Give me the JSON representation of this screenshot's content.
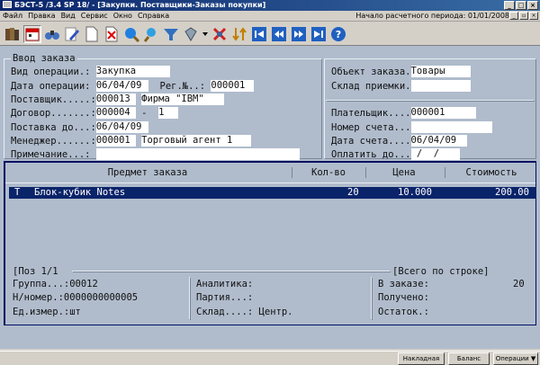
{
  "window": {
    "title": "БЭСТ-5 /3.4 SP 18/ - [Закупки. Поставщики-Заказы покупки]",
    "min": "_",
    "max": "□",
    "close": "×"
  },
  "menu": {
    "items": [
      "Файл",
      "Правка",
      "Вид",
      "Сервис",
      "Окно",
      "Справка"
    ],
    "period": "Начало расчетного периода: 01/01/2008"
  },
  "toolbar": {
    "icons": [
      "books-icon",
      "calendar-icon",
      "search-binoculars-icon",
      "edit-pencil-icon",
      "new-document-icon",
      "delete-icon",
      "filter-icon",
      "find-icon",
      "cancel-filter-icon",
      "arrow-down-icon",
      "cancel-icon",
      "sort-icon",
      "first-record-icon",
      "prev-record-icon",
      "next-record-icon",
      "last-record-icon",
      "help-icon"
    ]
  },
  "form": {
    "legend": "Ввод заказа",
    "left": {
      "op_type_label": "Вид операции.:",
      "op_type_value": "Закупка",
      "op_date_label": "Дата операции:",
      "op_date_value": "06/04/09",
      "reg_label": "Рег.№..:",
      "reg_value": "000001",
      "supplier_label": "Поставщик.....:",
      "supplier_code": "000013",
      "supplier_name": "Фирма \"IBM\"",
      "contract_label": "Договор.......:",
      "contract_code": "000004",
      "contract_dash": "-",
      "contract_num": "1",
      "delivery_label": "Поставка до...:",
      "delivery_value": "06/04/09",
      "manager_label": "Менеджер......:",
      "manager_code": "000001",
      "manager_name": "Торговый агент 1",
      "note_label": "Примечание...:"
    },
    "right": {
      "object_label": "Объект заказа.",
      "object_value": "Товары",
      "warehouse_label": "Склад приемки.",
      "payer_label": "Плательщик....",
      "payer_value": "000001",
      "invoice_label": "Номер счета...",
      "invoice_date_label": "Дата счета....",
      "invoice_date_value": "06/04/09",
      "pay_by_label": "Оплатить до...",
      "pay_by_value": " /  /"
    }
  },
  "table": {
    "headers": [
      "Предмет заказа",
      "Кол-во",
      "Цена",
      "Стоимость"
    ],
    "rows": [
      {
        "type": "T",
        "name": "Блок-кубик Notes",
        "qty": "20",
        "price": "10.000",
        "cost": "200.00"
      }
    ]
  },
  "footer": {
    "pos": "[Поз 1/1",
    "line_total": "[Всего по строке]",
    "group_label": "Группа...:",
    "group_value": "00012",
    "nnum_label": "Н/номер.:",
    "nnum_value": "0000000000005",
    "unit_label": "Ед.измер.:",
    "unit_value": "шт",
    "analytics_label": "Аналитика:",
    "batch_label": "Партия...:",
    "store_label": "Склад....:",
    "store_value": "Центр.",
    "in_order_label": "В заказе:",
    "in_order_value": "20",
    "received_label": "Получено:",
    "remain_label": "Остаток.:"
  },
  "statusbar": {
    "buttons": [
      "Накладная",
      "Баланс",
      "Операции ▼"
    ]
  }
}
